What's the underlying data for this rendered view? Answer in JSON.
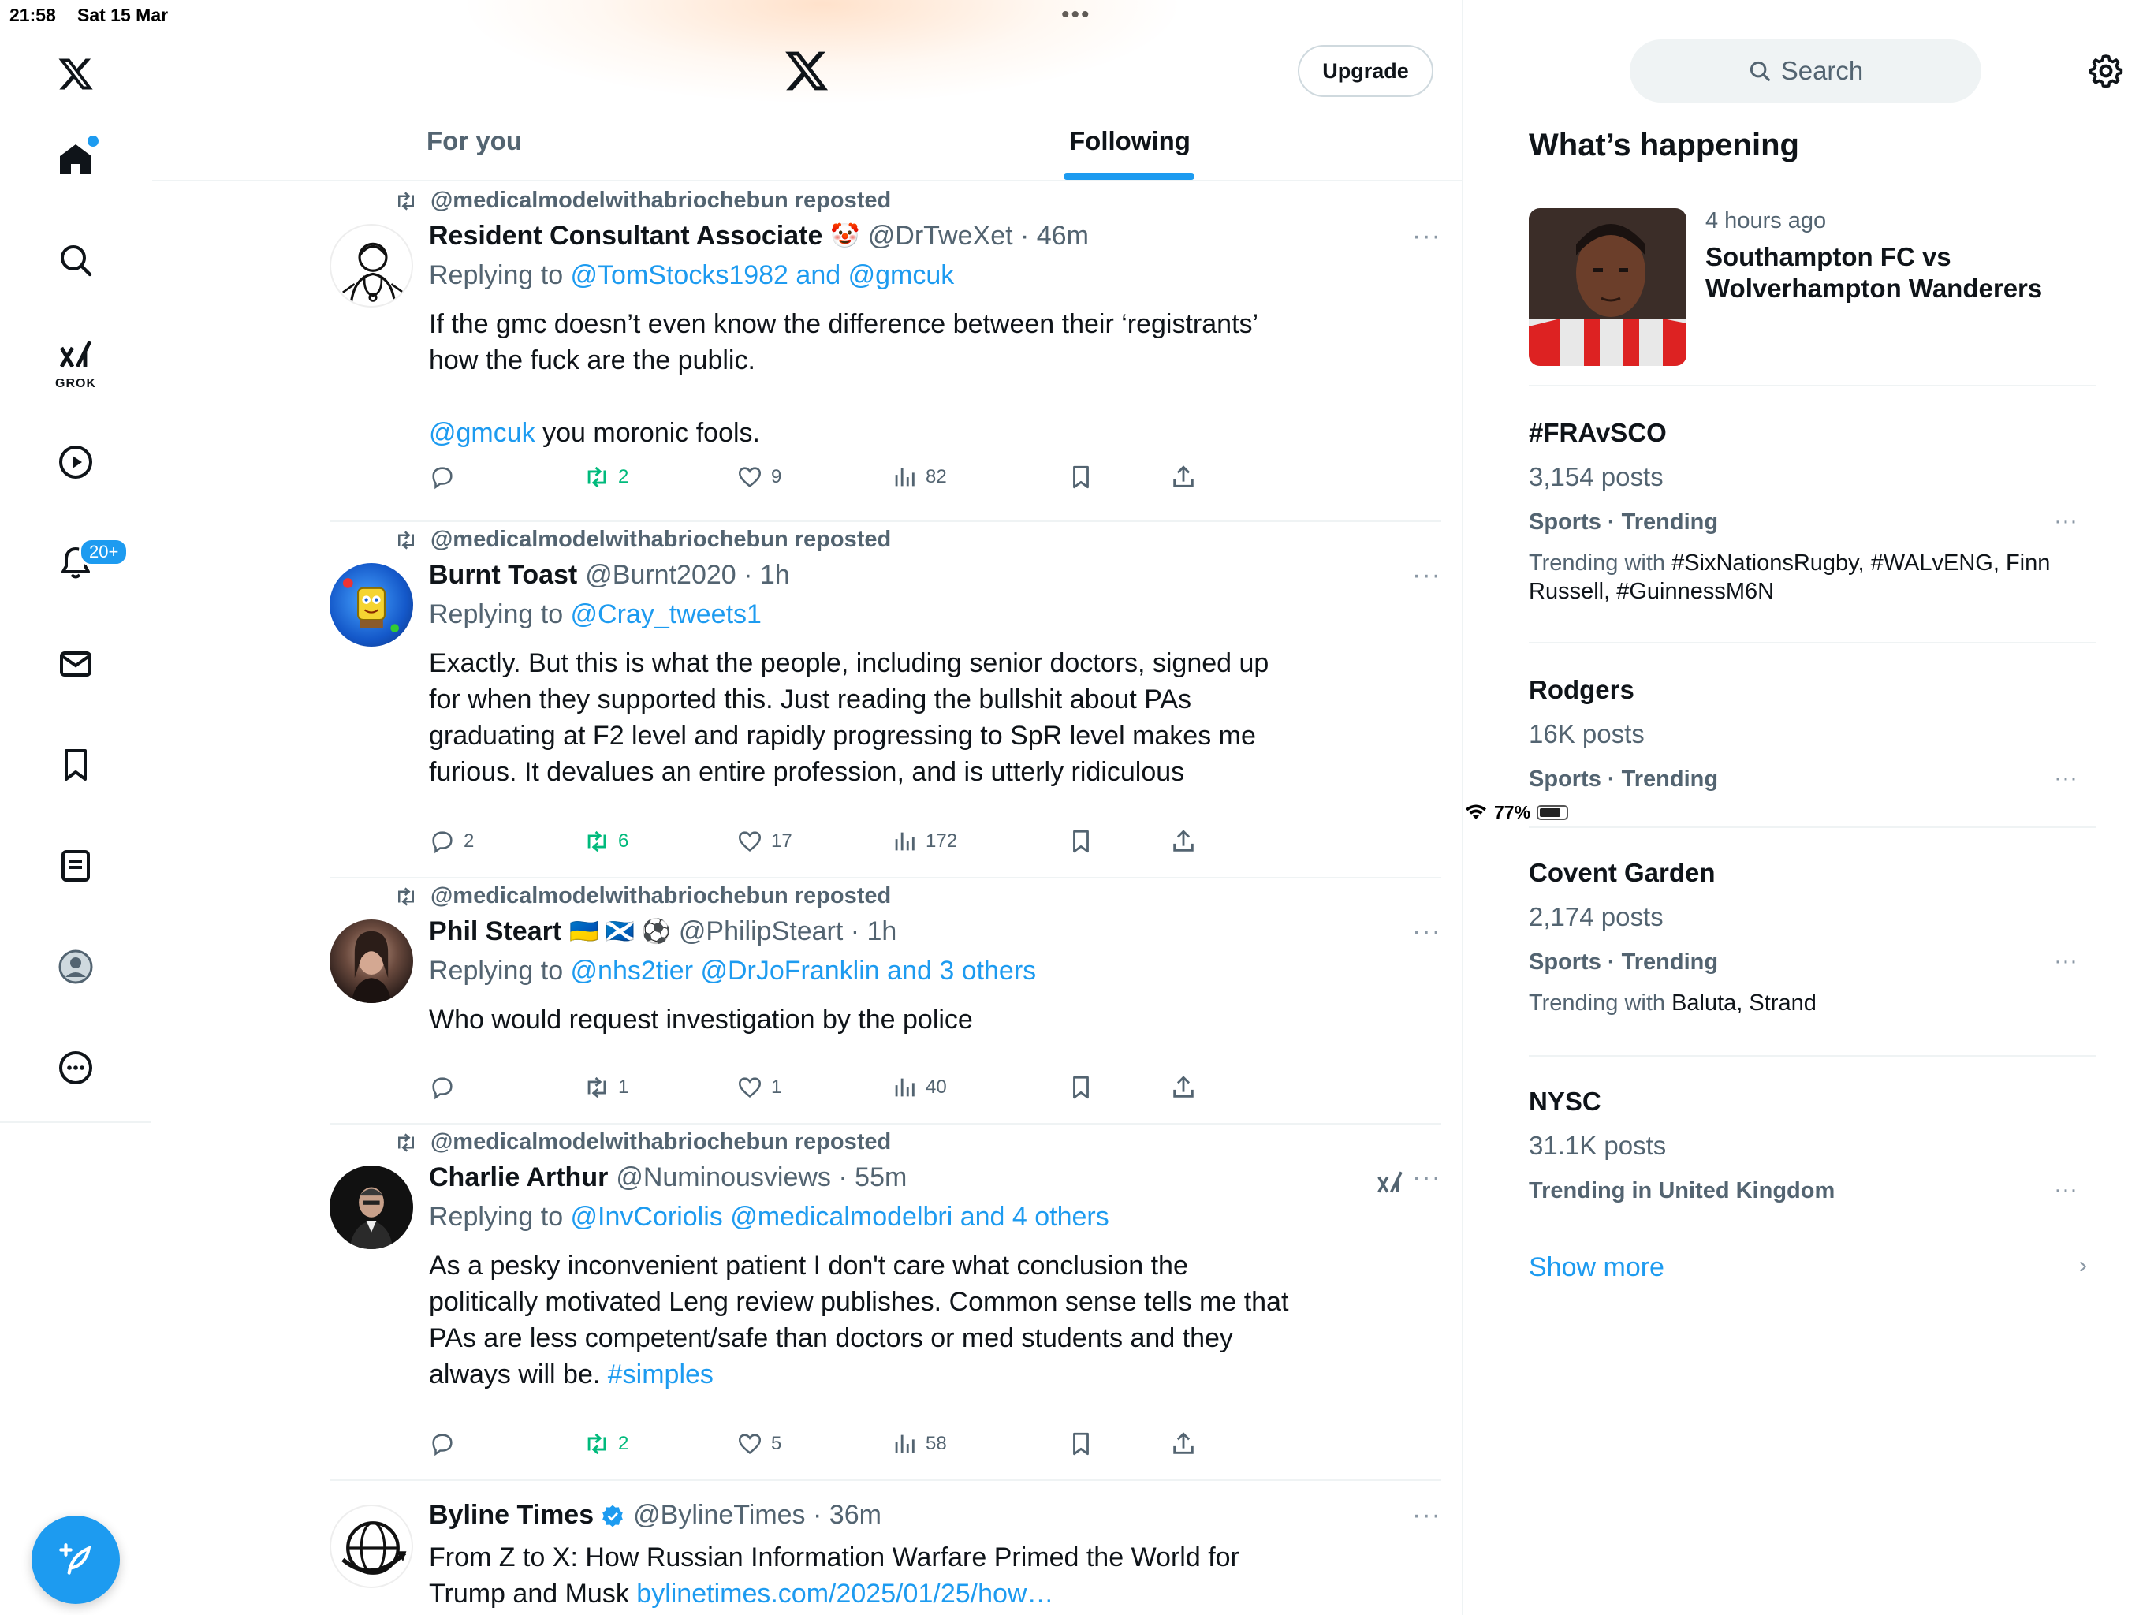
{
  "status_bar": {
    "time": "21:58",
    "date": "Sat 15 Mar",
    "battery": "77%"
  },
  "nav": {
    "grok_label": "GROK",
    "notifications_badge": "20+"
  },
  "header": {
    "upgrade_label": "Upgrade"
  },
  "tabs": [
    {
      "label": "For you"
    },
    {
      "label": "Following"
    }
  ],
  "tweets": [
    {
      "repost": "@medicalmodelwithabriochebun reposted",
      "name": "Resident Consultant Associate",
      "emoji": "🤡",
      "handle": "@DrTweXet",
      "time": "46m",
      "replying_prefix": "Replying to ",
      "replying_to": "@TomStocks1982 and @gmcuk",
      "text_1": "If the gmc doesn’t even know the difference between their ‘registrants’ how the fuck are the public.",
      "text_2_link": "@gmcuk",
      "text_2": " you moronic fools.",
      "replies": "",
      "reposts": "2",
      "likes": "9",
      "views": "82"
    },
    {
      "repost": "@medicalmodelwithabriochebun reposted",
      "name": "Burnt Toast",
      "handle": "@Burnt2020",
      "time": "1h",
      "replying_prefix": "Replying to ",
      "replying_to": "@Cray_tweets1",
      "text": "Exactly. But this is what the people, including senior doctors, signed up for when they supported this. Just reading the bullshit about PAs graduating at F2 level and rapidly progressing to SpR level makes me furious. It devalues an entire profession, and is utterly ridiculous",
      "replies": "2",
      "reposts": "6",
      "likes": "17",
      "views": "172"
    },
    {
      "repost": "@medicalmodelwithabriochebun reposted",
      "name": "Phil Steart",
      "emoji": "🇺🇦 🏴󠁧󠁢󠁳󠁣󠁴󠁿 ⚽",
      "handle": "@PhilipSteart",
      "time": "1h",
      "replying_prefix": "Replying to ",
      "replying_to": "@nhs2tier @DrJoFranklin and 3 others",
      "text": "Who would request investigation by the police",
      "replies": "",
      "reposts": "1",
      "likes": "1",
      "views": "40"
    },
    {
      "repost": "@medicalmodelwithabriochebun reposted",
      "name": "Charlie Arthur",
      "handle": "@Numinousviews",
      "time": "55m",
      "replying_prefix": "Replying to ",
      "replying_to": "@InvCoriolis @medicalmodelbri and 4 others",
      "text": "As a pesky inconvenient patient I don't care what conclusion the politically motivated Leng review publishes. Common sense tells me that PAs are less competent/safe than doctors or med students and they always will be. ",
      "hashtag": "#simples",
      "replies": "",
      "reposts": "2",
      "likes": "5",
      "views": "58"
    },
    {
      "name": "Byline Times",
      "handle": "@BylineTimes",
      "time": "36m",
      "text": "From Z to X: How Russian Information Warfare Primed the World for Trump and Musk ",
      "link": "bylinetimes.com/2025/01/25/how…"
    }
  ],
  "sidebar": {
    "search_placeholder": "Search",
    "title": "What’s happening",
    "news": {
      "time": "4 hours ago",
      "title": "Southampton FC vs Wolverhampton Wanderers"
    },
    "trends": [
      {
        "name": "#FRAvSCO",
        "posts": "3,154 posts",
        "category": "Sports · Trending",
        "with_prefix": "Trending with ",
        "with_tags": "#SixNationsRugby, #WALvENG, Finn Russell, #GuinnessM6N"
      },
      {
        "name": "Rodgers",
        "posts": "16K posts",
        "category": "Sports · Trending"
      },
      {
        "name": "Covent Garden",
        "posts": "2,174 posts",
        "category": "Sports · Trending",
        "with_prefix": "Trending with ",
        "with_tags": "Baluta, Strand"
      },
      {
        "name": "NYSC",
        "posts": "31.1K posts",
        "category": "Trending in United Kingdom"
      }
    ],
    "show_more": "Show more"
  },
  "colors": {
    "accent": "#1d9bf0",
    "repost_green": "#00ba7c",
    "secondary_text": "#536471"
  }
}
